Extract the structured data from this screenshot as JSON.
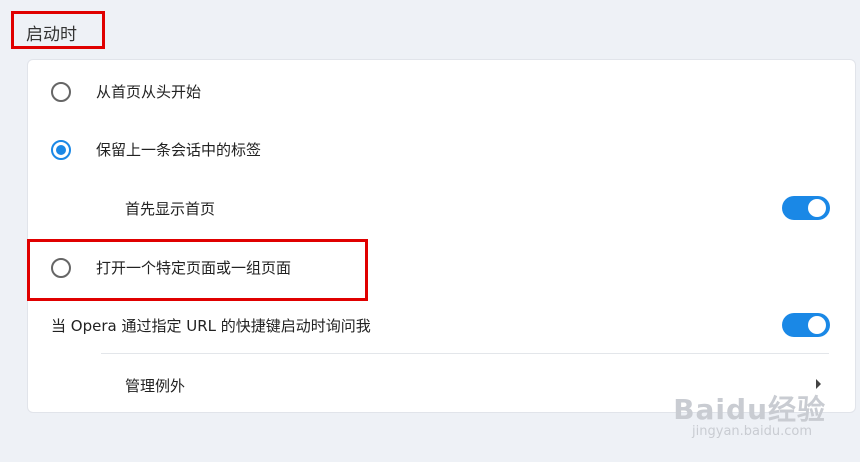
{
  "section": {
    "title": "启动时"
  },
  "options": [
    {
      "label": "从首页从头开始",
      "checked": false
    },
    {
      "label": "保留上一条会话中的标签",
      "checked": true
    },
    {
      "label": "打开一个特定页面或一组页面",
      "checked": false
    }
  ],
  "sub_option": {
    "label": "首先显示首页",
    "enabled": true
  },
  "url_prompt": {
    "label": "当 Opera 通过指定 URL 的快捷键启动时询问我",
    "enabled": true
  },
  "exceptions": {
    "label": "管理例外"
  },
  "watermark": {
    "brand": "Baidu经验",
    "url": "jingyan.baidu.com"
  },
  "colors": {
    "accent": "#1a88e6",
    "highlight": "#e00000",
    "background": "#eef1f6"
  }
}
